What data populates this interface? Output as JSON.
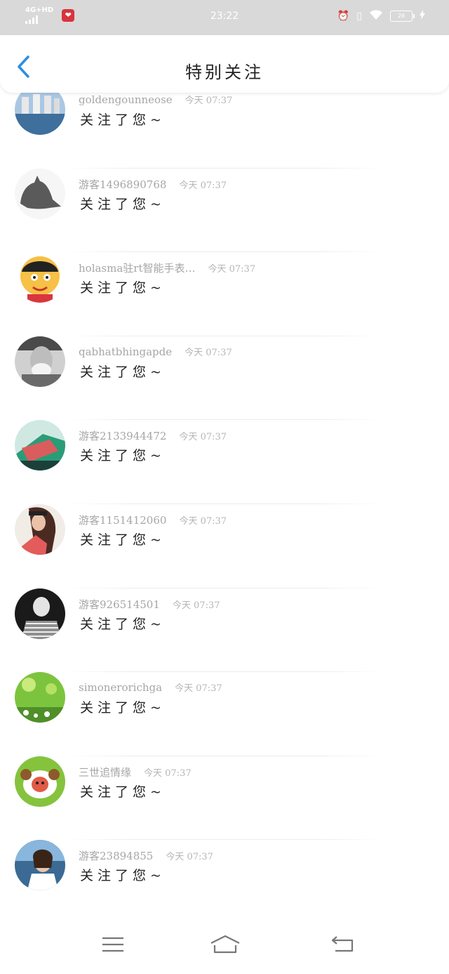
{
  "status_bar": {
    "network": "4G+HD",
    "time": "23:22",
    "battery": "26"
  },
  "header": {
    "title": "特别关注"
  },
  "items": [
    {
      "name": "goldengounneose",
      "time": "今天 07:37",
      "message": "关注了您~",
      "avatar_color": "#5e8fc0"
    },
    {
      "name": "游客1496890768",
      "time": "今天 07:37",
      "message": "关注了您~",
      "avatar_color": "#7a7a7a"
    },
    {
      "name": "holasma驻rt智能手表…",
      "time": "今天 07:37",
      "message": "关注了您~",
      "avatar_color": "#f1b23b"
    },
    {
      "name": "qabhatbhingapde",
      "time": "今天 07:37",
      "message": "关注了您~",
      "avatar_color": "#8a8a8a"
    },
    {
      "name": "游客2133944472",
      "time": "今天 07:37",
      "message": "关注了您~",
      "avatar_color": "#2fa27f"
    },
    {
      "name": "游客1151412060",
      "time": "今天 07:37",
      "message": "关注了您~",
      "avatar_color": "#d97c7a"
    },
    {
      "name": "游客926514501",
      "time": "今天 07:37",
      "message": "关注了您~",
      "avatar_color": "#4a4a4a"
    },
    {
      "name": "simonerorichga",
      "time": "今天 07:37",
      "message": "关注了您~",
      "avatar_color": "#79c23f"
    },
    {
      "name": "三世追情缘",
      "time": "今天 07:37",
      "message": "关注了您~",
      "avatar_color": "#86c341"
    },
    {
      "name": "游客23894855",
      "time": "今天 07:37",
      "message": "关注了您~",
      "avatar_color": "#3b6a94"
    }
  ]
}
